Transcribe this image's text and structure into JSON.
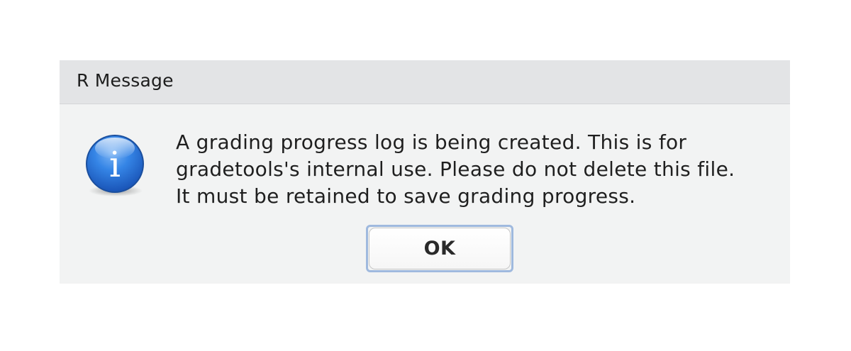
{
  "dialog": {
    "title": "R Message",
    "icon": "info-icon",
    "icon_glyph": "i",
    "message_lines": [
      "A grading progress log is being created. This is for",
      "gradetools's internal use. Please do not delete this file.",
      "It must be retained to save grading progress."
    ],
    "ok_label": "OK"
  },
  "colors": {
    "titlebar": "#e3e4e6",
    "dialog_background": "#f2f3f3",
    "icon_blue": "#2f7fe0",
    "focus_ring": "#9fb9de"
  }
}
